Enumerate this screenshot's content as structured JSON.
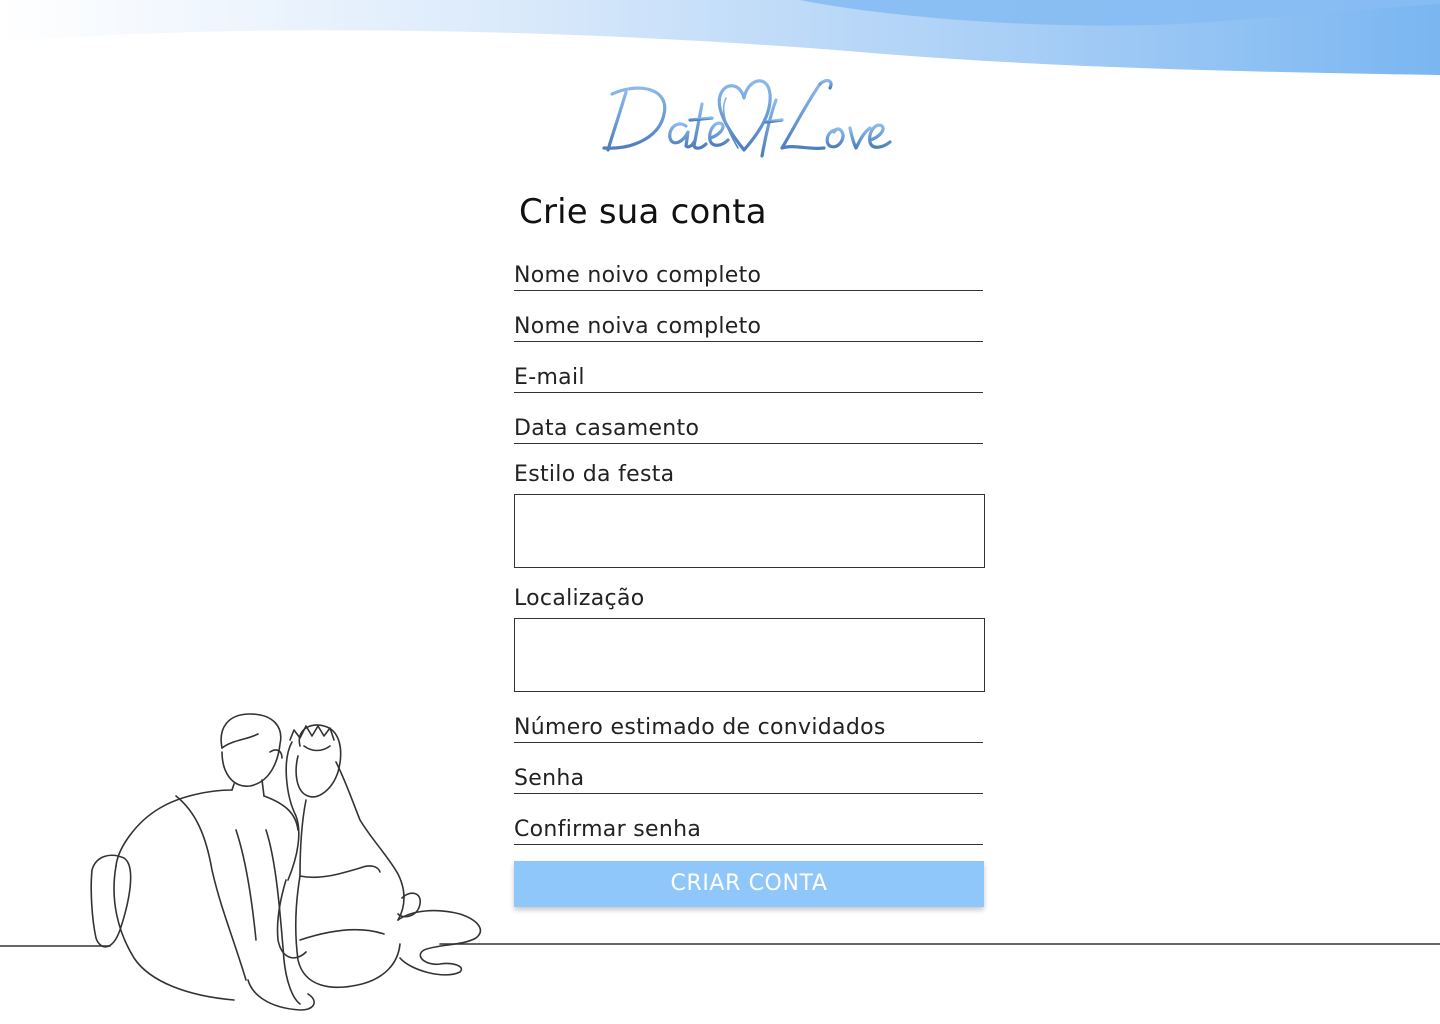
{
  "brand": {
    "logo_text": "DateOfLove"
  },
  "form": {
    "title": "Crie sua conta",
    "fields": {
      "groom_name": "Nome noivo completo",
      "bride_name": "Nome noiva completo",
      "email": "E-mail",
      "wedding_date": "Data casamento",
      "party_style": "Estilo da festa",
      "location": "Localização",
      "guest_count": "Número estimado de convidados",
      "password": "Senha",
      "confirm_password": "Confirmar senha"
    },
    "submit_label": "CRIAR CONTA"
  },
  "colors": {
    "accent": "#90c7fb",
    "wave": "#7ab6f1",
    "logo": "#6c9ed6"
  }
}
